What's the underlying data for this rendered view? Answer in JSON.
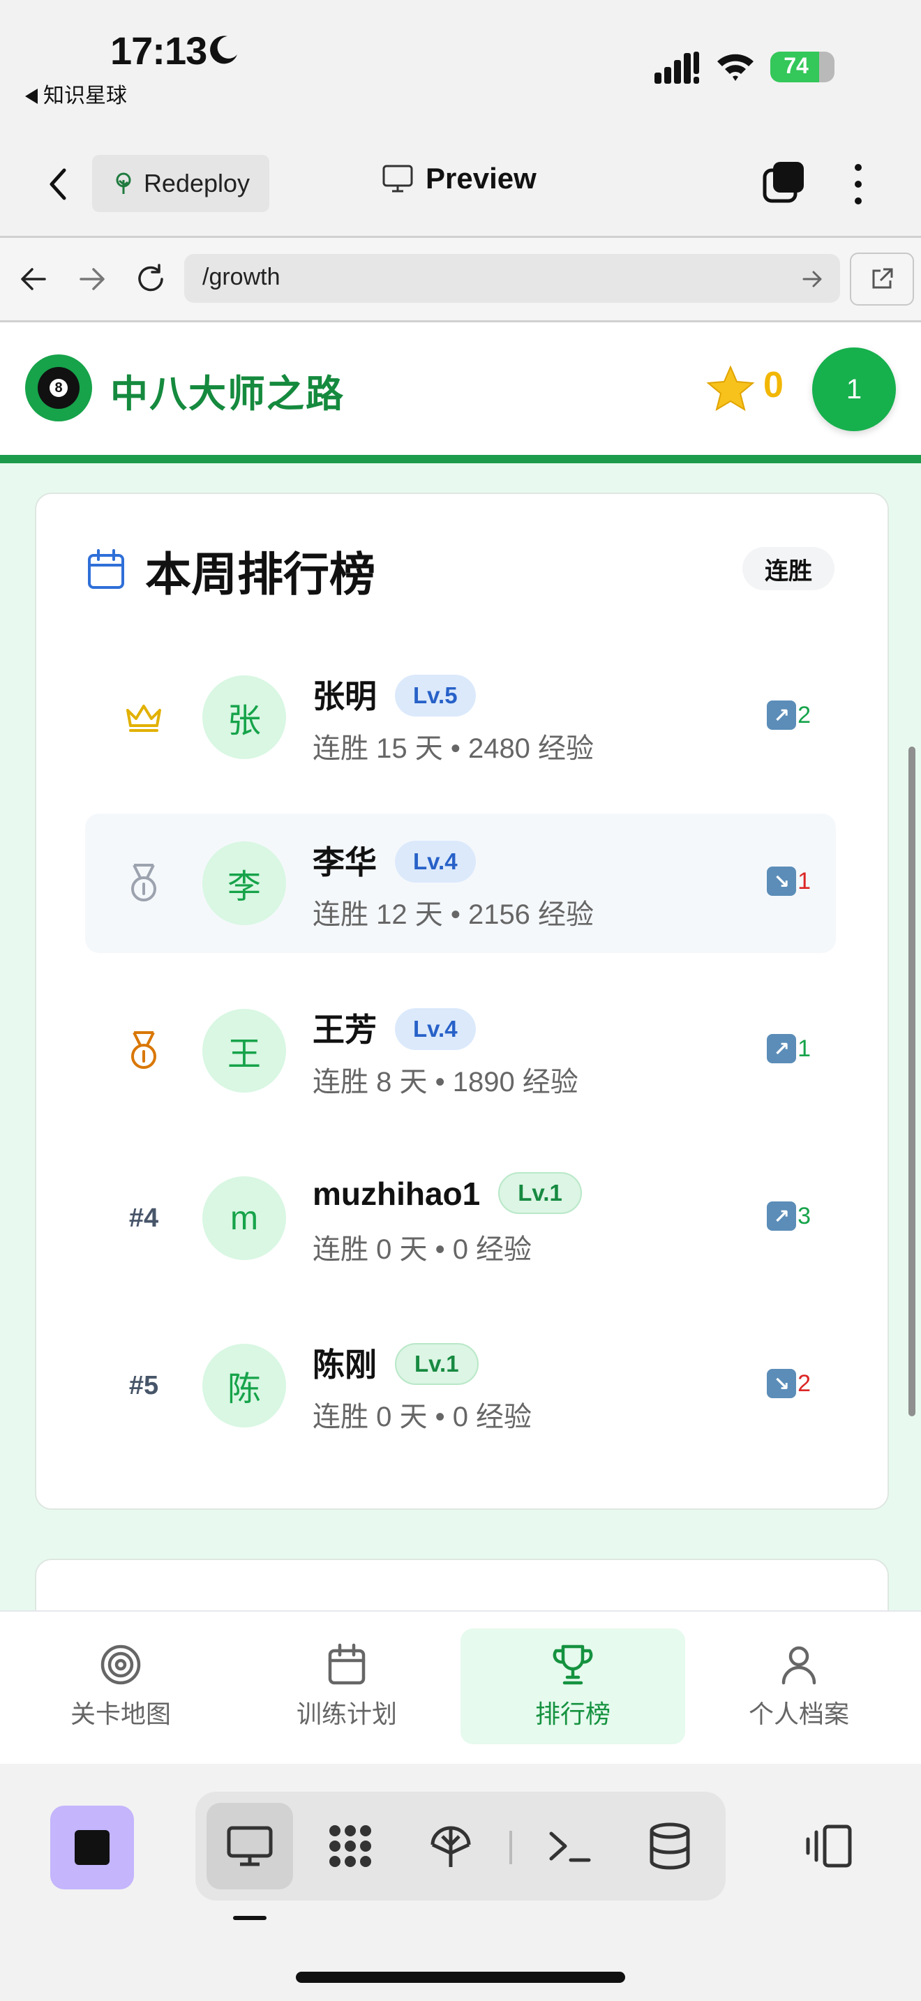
{
  "status_bar": {
    "time": "17:13",
    "back_app": "知识星球",
    "battery": "74"
  },
  "toolbar": {
    "redeploy_label": "Redeploy",
    "preview_label": "Preview"
  },
  "url_bar": {
    "path": "/growth"
  },
  "header": {
    "brand": "中八大师之路",
    "ball_number": "8",
    "stars": "0",
    "level": "1"
  },
  "leaderboard": {
    "title": "本周排行榜",
    "filter_chip": "连胜",
    "rows": [
      {
        "rank_icon": "crown-icon",
        "rank_label": "",
        "avatar": "张",
        "name": "张明",
        "level": "Lv.5",
        "level_style": "blue",
        "stats": "连胜 15 天 • 2480 经验",
        "trend_dir": "up",
        "trend_value": "2"
      },
      {
        "rank_icon": "silver-medal-icon",
        "rank_label": "",
        "avatar": "李",
        "name": "李华",
        "level": "Lv.4",
        "level_style": "blue",
        "stats": "连胜 12 天 • 2156 经验",
        "trend_dir": "down",
        "trend_value": "1"
      },
      {
        "rank_icon": "bronze-medal-icon",
        "rank_label": "",
        "avatar": "王",
        "name": "王芳",
        "level": "Lv.4",
        "level_style": "blue",
        "stats": "连胜 8 天 • 1890 经验",
        "trend_dir": "up",
        "trend_value": "1"
      },
      {
        "rank_icon": "",
        "rank_label": "#4",
        "avatar": "m",
        "name": "muzhihao1",
        "level": "Lv.1",
        "level_style": "green",
        "stats": "连胜 0 天 • 0 经验",
        "trend_dir": "up",
        "trend_value": "3"
      },
      {
        "rank_icon": "",
        "rank_label": "#5",
        "avatar": "陈",
        "name": "陈刚",
        "level": "Lv.1",
        "level_style": "green",
        "stats": "连胜 0 天 • 0 经验",
        "trend_dir": "down",
        "trend_value": "2"
      }
    ]
  },
  "bottom_nav": [
    {
      "label": "关卡地图",
      "icon": "target-icon",
      "active": false
    },
    {
      "label": "训练计划",
      "icon": "calendar-icon",
      "active": false
    },
    {
      "label": "排行榜",
      "icon": "trophy-icon",
      "active": true
    },
    {
      "label": "个人档案",
      "icon": "user-icon",
      "active": false
    }
  ],
  "colors": {
    "brand_green": "#158a3e",
    "accent_green": "#16b04d",
    "star_yellow": "#f2b705",
    "trend_up": "#16a34a",
    "trend_down": "#dc2626",
    "level_blue": "#2761c8"
  }
}
